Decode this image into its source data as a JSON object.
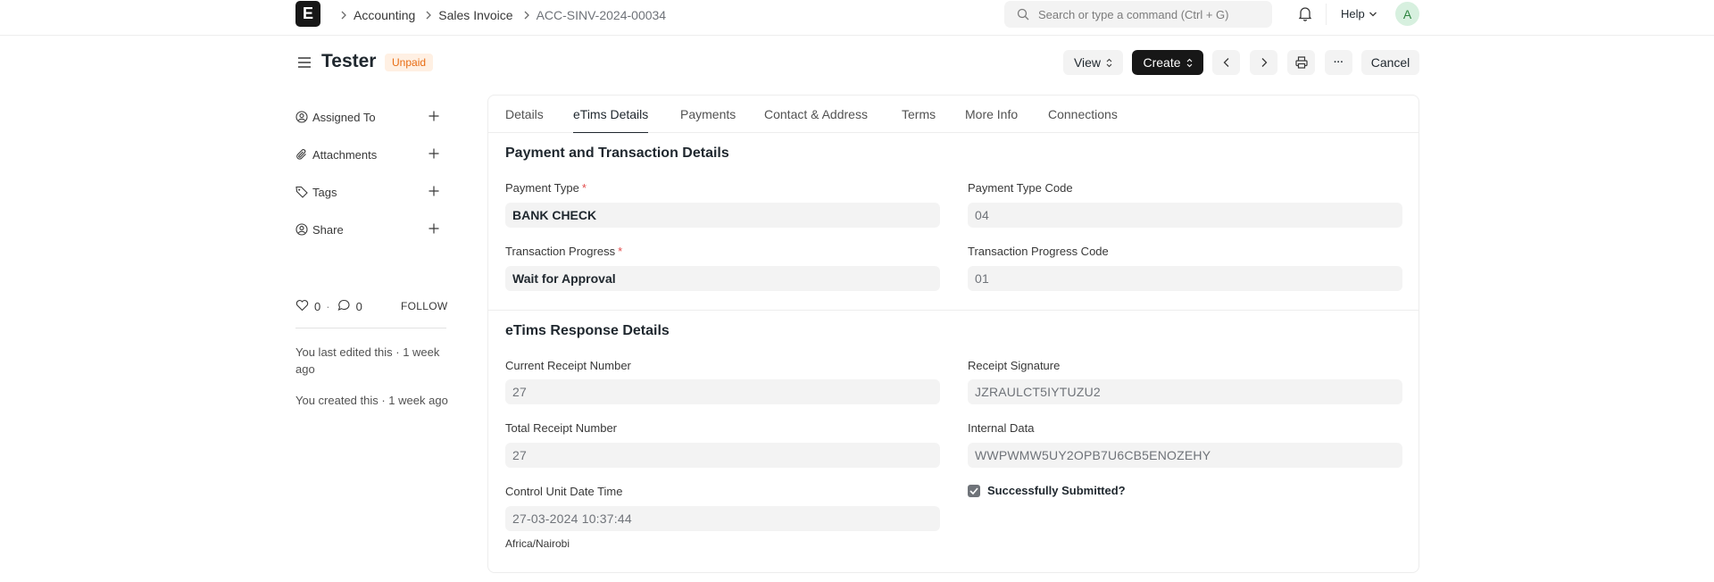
{
  "navbar": {
    "logo_letter": "E",
    "breadcrumbs": [
      "Accounting",
      "Sales Invoice",
      "ACC-SINV-2024-00034"
    ],
    "search_placeholder": "Search or type a command (Ctrl + G)",
    "help_label": "Help",
    "avatar_letter": "A"
  },
  "page": {
    "title": "Tester",
    "status": "Unpaid",
    "status_color": "#e86c13",
    "actions": {
      "view": "View",
      "create": "Create",
      "more": "···",
      "cancel": "Cancel"
    }
  },
  "sidebar": {
    "items": [
      {
        "label": "Assigned To",
        "icon": "assign-icon"
      },
      {
        "label": "Attachments",
        "icon": "paperclip-icon"
      },
      {
        "label": "Tags",
        "icon": "tag-icon"
      },
      {
        "label": "Share",
        "icon": "share-icon"
      }
    ],
    "likes": "0",
    "comments": "0",
    "follow": "FOLLOW",
    "activity": [
      "You last edited this · 1 week ago",
      "You created this · 1 week ago"
    ]
  },
  "tabs": [
    "Details",
    "eTims Details",
    "Payments",
    "Contact & Address",
    "Terms",
    "More Info",
    "Connections"
  ],
  "active_tab": "eTims Details",
  "sections": {
    "payment": {
      "title": "Payment and Transaction Details",
      "payment_type_label": "Payment Type",
      "payment_type_value": "BANK CHECK",
      "payment_type_code_label": "Payment Type Code",
      "payment_type_code_value": "04",
      "transaction_progress_label": "Transaction Progress",
      "transaction_progress_value": "Wait for Approval",
      "transaction_progress_code_label": "Transaction Progress Code",
      "transaction_progress_code_value": "01",
      "required_mark": "*"
    },
    "response": {
      "title": "eTims Response Details",
      "current_receipt_label": "Current Receipt Number",
      "current_receipt_value": "27",
      "receipt_signature_label": "Receipt Signature",
      "receipt_signature_value": "JZRAULCT5IYTUZU2",
      "total_receipt_label": "Total Receipt Number",
      "total_receipt_value": "27",
      "internal_data_label": "Internal Data",
      "internal_data_value": "WWPWMW5UY2OPB7U6CB5ENOZEHY",
      "control_unit_label": "Control Unit Date Time",
      "control_unit_value": "27-03-2024 10:37:44",
      "timezone": "Africa/Nairobi",
      "submitted_label": "Successfully Submitted?",
      "submitted_checked": true
    }
  }
}
